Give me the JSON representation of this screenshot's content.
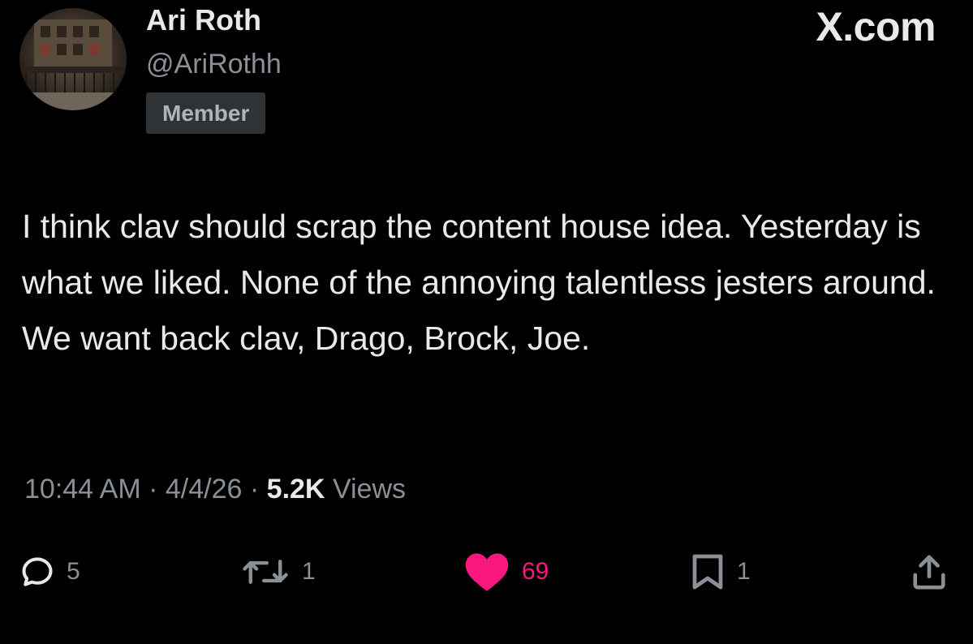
{
  "author": {
    "display_name": "Ari Roth",
    "handle": "@AriRothh",
    "badge": "Member"
  },
  "brand": "X.com",
  "post": {
    "text": "I think clav should scrap the content house idea. Yesterday is what we liked. None of the annoying talentless jesters around. We want back clav, Drago, Brock, Joe."
  },
  "meta": {
    "time": "10:44 AM",
    "separator": "·",
    "date": "4/4/26",
    "views_count": "5.2K",
    "views_label": "Views"
  },
  "actions": {
    "reply": {
      "icon": "reply-icon",
      "count": "5"
    },
    "repost": {
      "icon": "repost-icon",
      "count": "1"
    },
    "like": {
      "icon": "heart-icon",
      "count": "69",
      "liked": true
    },
    "bookmark": {
      "icon": "bookmark-icon",
      "count": "1"
    },
    "share": {
      "icon": "share-icon"
    }
  },
  "colors": {
    "background": "#000000",
    "text": "#e7e9ea",
    "secondary_text": "#8b9096",
    "like_pink": "#f91880",
    "badge_bg": "#2f3336"
  }
}
